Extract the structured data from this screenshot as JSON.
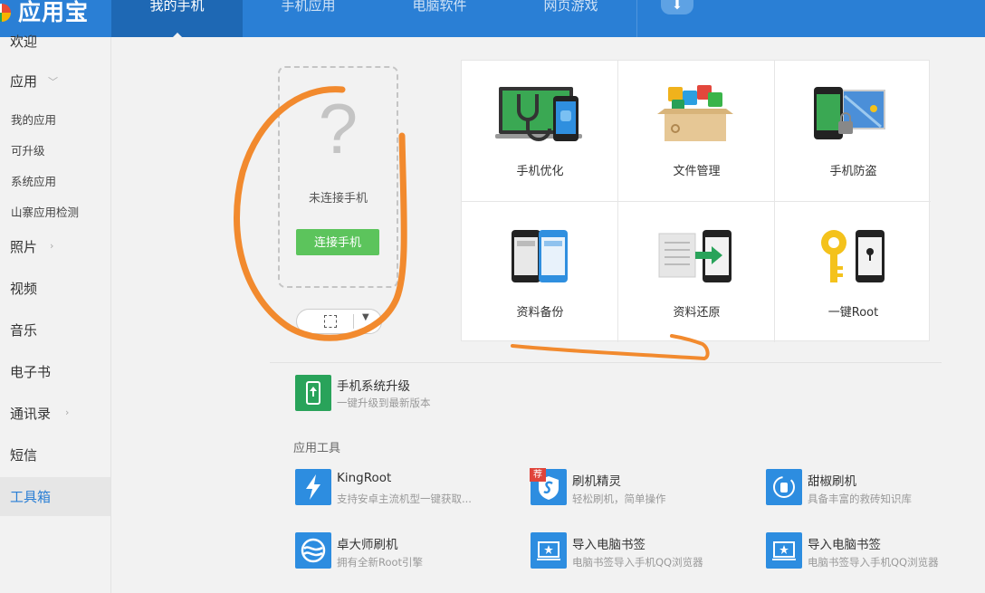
{
  "app": {
    "title": "应用宝"
  },
  "nav": {
    "tabs": [
      {
        "label": "我的手机",
        "active": true
      },
      {
        "label": "手机应用"
      },
      {
        "label": "电脑软件"
      },
      {
        "label": "网页游戏"
      }
    ],
    "download_icon": "download-icon"
  },
  "sidebar": {
    "items": [
      {
        "label": "欢迎"
      },
      {
        "label": "应用"
      },
      {
        "label": "我的应用"
      },
      {
        "label": "可升级"
      },
      {
        "label": "系统应用"
      },
      {
        "label": "山寨应用检测"
      },
      {
        "label": "照片"
      },
      {
        "label": "视频"
      },
      {
        "label": "音乐"
      },
      {
        "label": "电子书"
      },
      {
        "label": "通讯录"
      },
      {
        "label": "短信"
      },
      {
        "label": "工具箱",
        "active": true
      }
    ]
  },
  "phone": {
    "question_mark": "?",
    "status": "未连接手机",
    "connect_label": "连接手机"
  },
  "features": [
    {
      "label": "手机优化",
      "icon": "phone-optimize-icon"
    },
    {
      "label": "文件管理",
      "icon": "file-manager-icon"
    },
    {
      "label": "手机防盗",
      "icon": "anti-theft-icon"
    },
    {
      "label": "资料备份",
      "icon": "backup-icon"
    },
    {
      "label": "资料还原",
      "icon": "restore-icon"
    },
    {
      "label": "一键Root",
      "icon": "root-key-icon"
    }
  ],
  "upgrade": {
    "title": "手机系统升级",
    "desc": "一键升级到最新版本"
  },
  "tools_section": {
    "title": "应用工具",
    "tools": [
      {
        "name": "KingRoot",
        "desc": "支持安卓主流机型一键获取...",
        "icon": "lightning-icon"
      },
      {
        "name": "刷机精灵",
        "desc": "轻松刷机，简单操作",
        "icon": "shield-s-icon",
        "badge": "荐"
      },
      {
        "name": "甜椒刷机",
        "desc": "具备丰富的救砖知识库",
        "icon": "refresh-hand-icon"
      },
      {
        "name": "卓大师刷机",
        "desc": "拥有全新Root引擎",
        "icon": "wave-circle-icon"
      },
      {
        "name": "导入电脑书签",
        "desc": "电脑书签导入手机QQ浏览器",
        "icon": "bookmark-import-icon"
      },
      {
        "name": "导入电脑书签",
        "desc": "电脑书签导入手机QQ浏览器",
        "icon": "bookmark-import-icon"
      }
    ]
  },
  "colors": {
    "topbar": "#2a7fd5",
    "active_tab": "#1e68b4",
    "connect_green": "#5cc45c",
    "tool_blue": "#2d8de0",
    "upgrade_green": "#29a35a",
    "annotation_orange": "#f28a2e"
  }
}
